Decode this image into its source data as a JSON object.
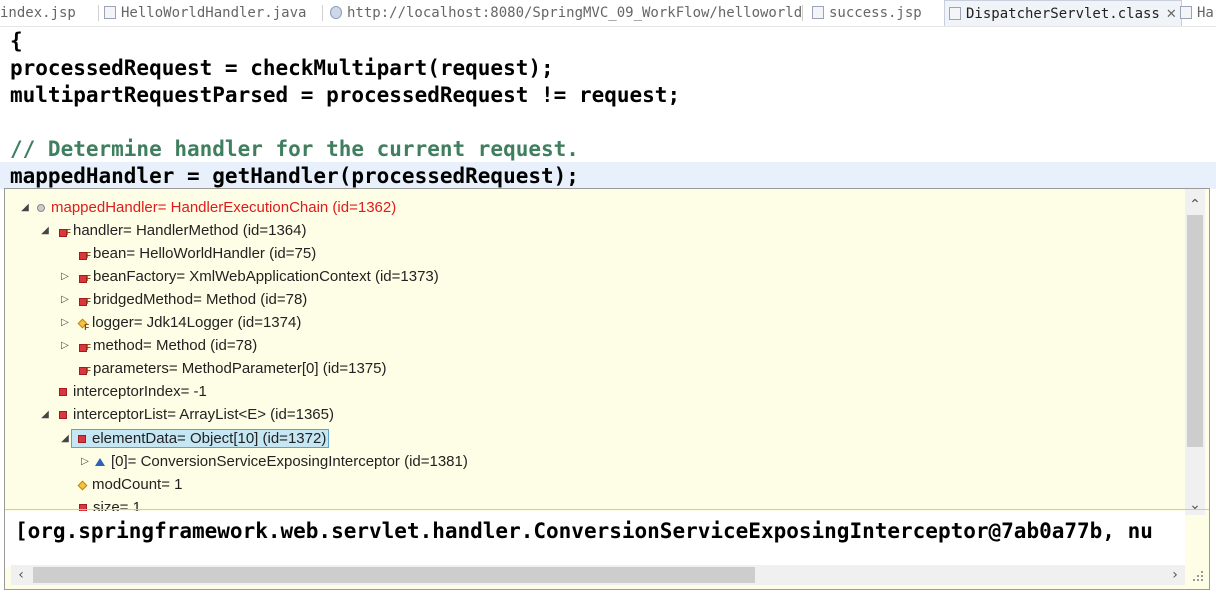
{
  "tabs": [
    {
      "label": "index.jsp",
      "icon": "jsp-file-icon"
    },
    {
      "label": "HelloWorldHandler.java",
      "icon": "java-file-icon"
    },
    {
      "label": "http://localhost:8080/SpringMVC_09_WorkFlow/helloworld",
      "icon": "web-browser-icon"
    },
    {
      "label": "success.jsp",
      "icon": "jsp-file-icon"
    },
    {
      "label": "DispatcherServlet.class",
      "icon": "class-file-icon",
      "close": "✕"
    },
    {
      "label": "Ha",
      "icon": "java-file-icon"
    }
  ],
  "code": {
    "lines": [
      "{",
      "processedRequest = checkMultipart(request);",
      "multipartRequestParsed = processedRequest != request;",
      "",
      "// Determine handler for the current request.",
      "mappedHandler = getHandler(processedRequest);"
    ]
  },
  "debug_popup": {
    "rows": [
      {
        "text": "mappedHandler= HandlerExecutionChain  (id=1362)"
      },
      {
        "text": "handler= HandlerMethod  (id=1364)"
      },
      {
        "text": "bean= HelloWorldHandler  (id=75)"
      },
      {
        "text": "beanFactory= XmlWebApplicationContext  (id=1373)"
      },
      {
        "text": "bridgedMethod= Method  (id=78)"
      },
      {
        "text": "logger= Jdk14Logger  (id=1374)"
      },
      {
        "text": "method= Method  (id=78)"
      },
      {
        "text": "parameters= MethodParameter[0]  (id=1375)"
      },
      {
        "text": "interceptorIndex= -1"
      },
      {
        "text": "interceptorList= ArrayList<E>  (id=1365)"
      },
      {
        "text": "elementData= Object[10]  (id=1372)"
      },
      {
        "text": "[0]= ConversionServiceExposingInterceptor  (id=1381)"
      },
      {
        "text": "modCount= 1"
      },
      {
        "text": "size= 1"
      }
    ],
    "detail": "[org.springframework.web.servlet.handler.ConversionServiceExposingInterceptor@7ab0a77b, nu",
    "accent_colors": {
      "root_label": "#e11b1b",
      "selection": "#c5e6f3",
      "background": "#fefee6"
    }
  }
}
